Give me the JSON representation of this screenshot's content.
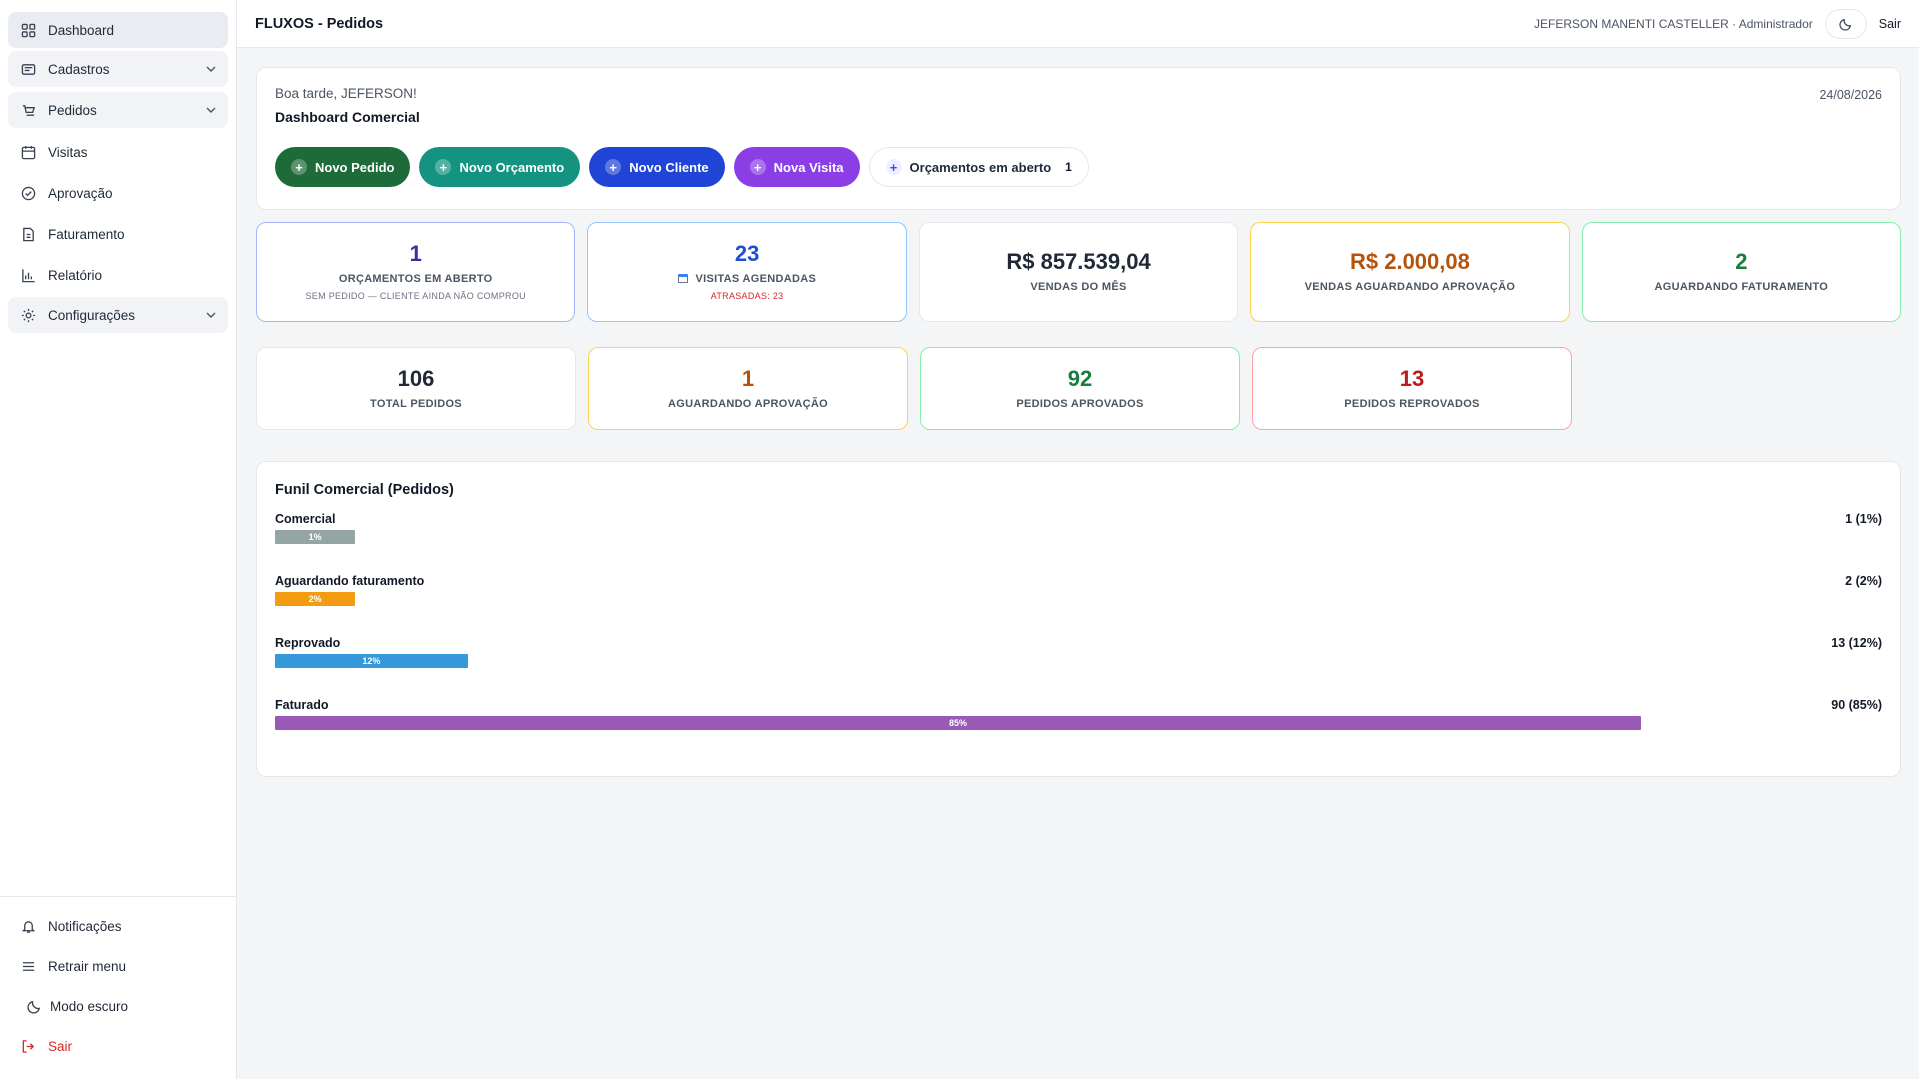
{
  "sidebar": {
    "items": [
      {
        "label": "Dashboard",
        "icon": "grid-icon",
        "active": true
      },
      {
        "label": "Cadastros",
        "icon": "folder-icon",
        "group": true
      },
      {
        "label": "Pedidos",
        "icon": "cart-icon",
        "group": true
      },
      {
        "label": "Visitas",
        "icon": "calendar-icon"
      },
      {
        "label": "Aprovação",
        "icon": "check-circle-icon"
      },
      {
        "label": "Faturamento",
        "icon": "invoice-icon"
      },
      {
        "label": "Relatório",
        "icon": "bar-chart-icon"
      },
      {
        "label": "Configurações",
        "icon": "gear-icon",
        "group": true
      }
    ],
    "bottom": {
      "notifications": "Notificações",
      "collapse": "Retrair menu",
      "dark_mode": "Modo escuro",
      "logout": "Sair"
    }
  },
  "topbar": {
    "title": "FLUXOS - Pedidos",
    "user": "JEFERSON MANENTI CASTELLER · Administrador",
    "logout": "Sair"
  },
  "welcome": {
    "greeting": "Boa tarde, JEFERSON!",
    "title": "Dashboard Comercial",
    "date": "24/08/2026",
    "actions": {
      "novo_pedido": "Novo Pedido",
      "novo_orcamento": "Novo Orçamento",
      "novo_cliente": "Novo Cliente",
      "nova_visita": "Nova Visita",
      "orcamentos_aberto": "Orçamentos em aberto",
      "orcamentos_count": "1"
    }
  },
  "kpis_row1": [
    {
      "value": "1",
      "label": "ORÇAMENTOS EM ABERTO",
      "sub": "SEM PEDIDO — CLIENTE AINDA NÃO COMPROU",
      "color": "#3730a3",
      "border": "#a5b4fc"
    },
    {
      "value": "23",
      "label": "VISITAS AGENDADAS",
      "sub": "ATRASADAS: 23",
      "color": "#1d4ed8",
      "border": "#93c5fd"
    },
    {
      "value": "R$ 857.539,04",
      "label": "VENDAS DO MÊS",
      "color": "#1f2937",
      "border": "#e5e7eb"
    },
    {
      "value": "R$ 2.000,08",
      "label": "VENDAS AGUARDANDO APROVAÇÃO",
      "color": "#b45309",
      "border": "#fcd34d"
    },
    {
      "value": "2",
      "label": "AGUARDANDO FATURAMENTO",
      "color": "#15803d",
      "border": "#86efac"
    }
  ],
  "kpis_row2": [
    {
      "value": "106",
      "label": "TOTAL PEDIDOS",
      "color": "#1f2937",
      "border": "#e5e7eb"
    },
    {
      "value": "1",
      "label": "AGUARDANDO APROVAÇÃO",
      "color": "#b45309",
      "border": "#fcd34d"
    },
    {
      "value": "92",
      "label": "PEDIDOS APROVADOS",
      "color": "#15803d",
      "border": "#86efac"
    },
    {
      "value": "13",
      "label": "PEDIDOS REPROVADOS",
      "color": "#b91c1c",
      "border": "#fca5a5"
    }
  ],
  "funnel": {
    "title": "Funil Comercial (Pedidos)",
    "rows": [
      {
        "name": "Comercial",
        "stat": "1 (1%)",
        "pct_label": "1%",
        "fraction": 0.05,
        "color": "#95a5a6"
      },
      {
        "name": "Aguardando faturamento",
        "stat": "2 (2%)",
        "pct_label": "2%",
        "fraction": 0.05,
        "color": "#f39c12"
      },
      {
        "name": "Reprovado",
        "stat": "13 (12%)",
        "pct_label": "12%",
        "fraction": 0.12,
        "color": "#3498db"
      },
      {
        "name": "Faturado",
        "stat": "90 (85%)",
        "pct_label": "85%",
        "fraction": 0.85,
        "color": "#9b59b6"
      }
    ]
  },
  "colors": {
    "novo_pedido": "#1e6b3a",
    "novo_orcamento": "#149381",
    "novo_cliente": "#1f44d6",
    "nova_visita": "#8b3ee6"
  }
}
